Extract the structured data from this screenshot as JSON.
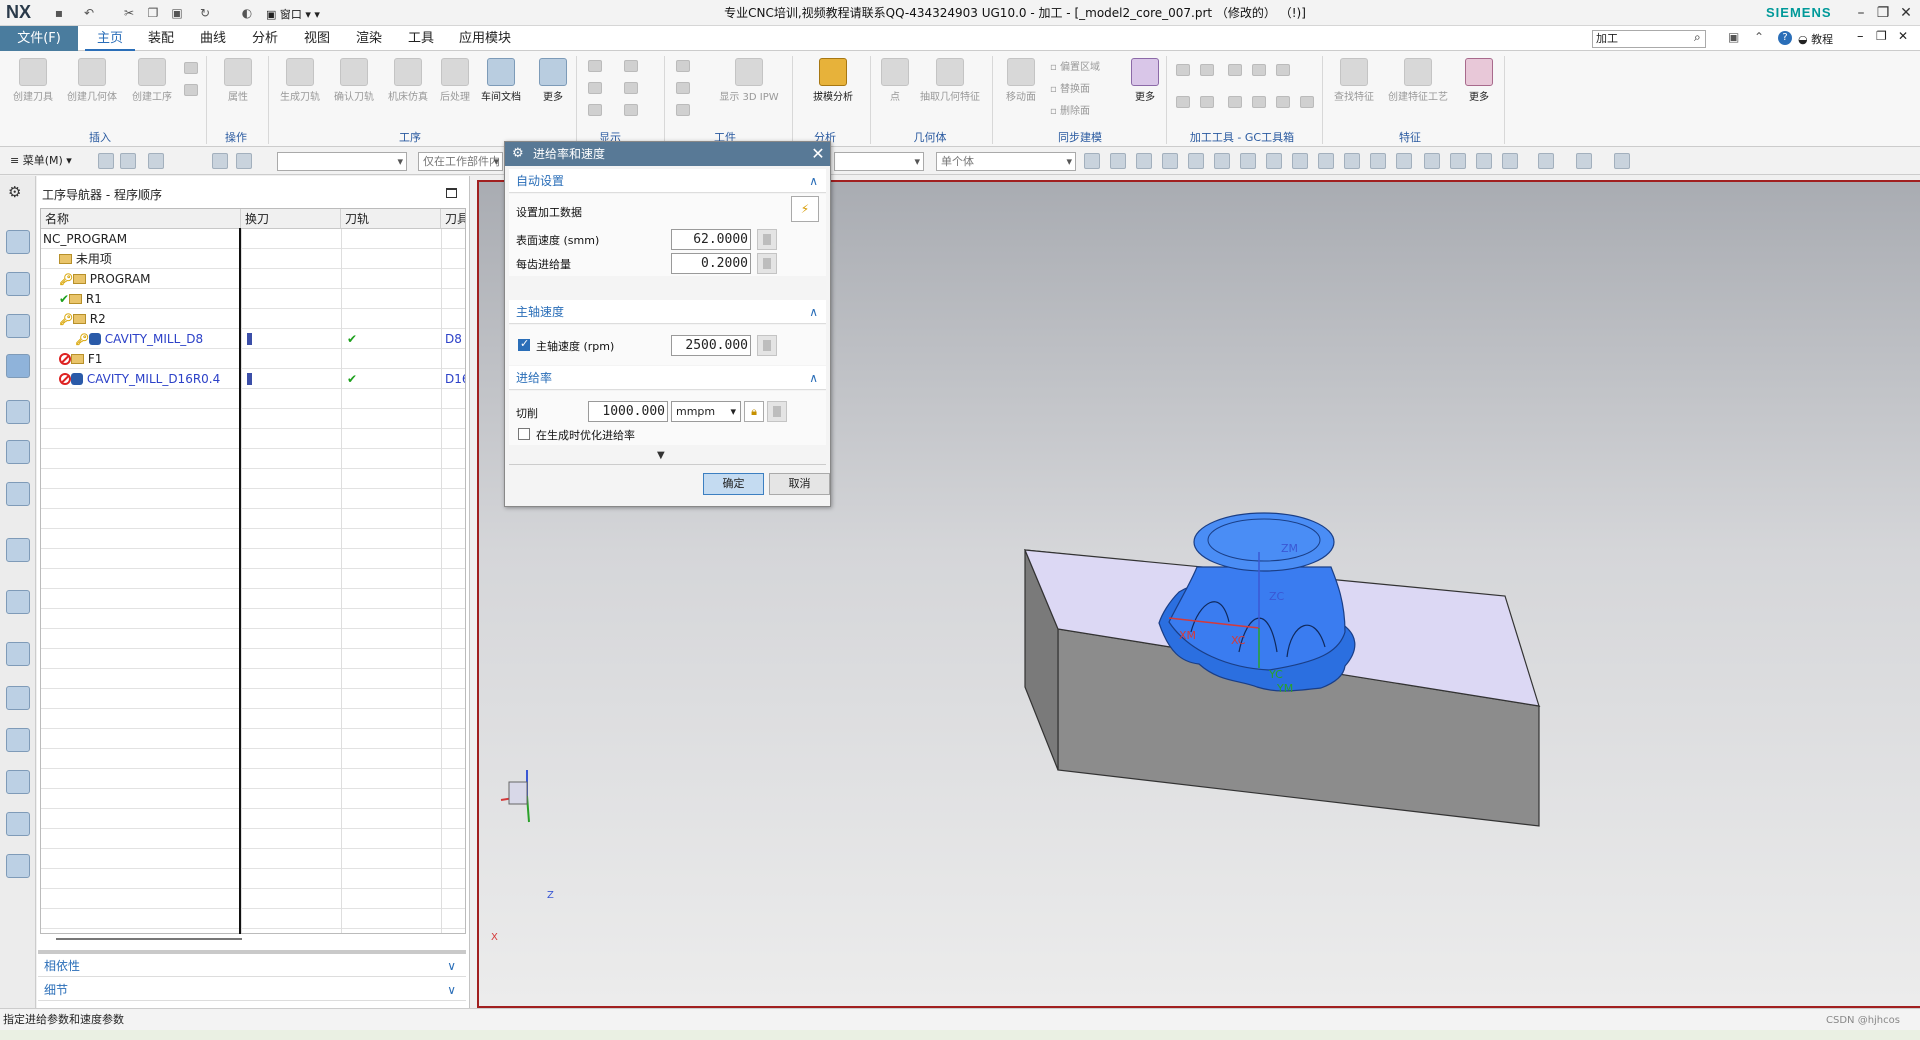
{
  "app": {
    "logo": "NX",
    "title": "专业CNC培训,视频教程请联系QQ-434324903 UG10.0 - 加工 - [_model2_core_007.prt （修改的） （!)]",
    "brand": "SIEMENS",
    "window_label": "窗口",
    "help_label": "教程"
  },
  "menu": {
    "file": "文件(F)",
    "tabs": [
      "主页",
      "装配",
      "曲线",
      "分析",
      "视图",
      "渲染",
      "工具",
      "应用模块"
    ],
    "search_value": "加工"
  },
  "ribbon": {
    "buttons": [
      "创建刀具",
      "创建几何体",
      "创建工序",
      "属性",
      "生成刀轨",
      "确认刀轨",
      "机床仿真",
      "后处理",
      "车间文档",
      "更多",
      "显示 3D IPW",
      "拔模分析",
      "点",
      "抽取几何特征",
      "移动面",
      "删除面",
      "替换面",
      "偏置区域",
      "更多",
      "查找特征",
      "创建特征工艺",
      "更多"
    ],
    "groups": [
      "插入",
      "操作",
      "工序",
      "显示",
      "工件",
      "分析",
      "几何体",
      "同步建模",
      "加工工具 - GC工具箱",
      "特征"
    ]
  },
  "toolbar": {
    "menu_label": "菜单(M)",
    "filter_placeholder": "仅在工作部件内",
    "body_filter": "单个体",
    "blank_combo": ""
  },
  "navigator": {
    "title": "工序导航器 - 程序顺序",
    "columns": [
      "名称",
      "换刀",
      "刀轨",
      "刀具"
    ],
    "rows": [
      {
        "name": "NC_PROGRAM",
        "depth": 0,
        "status": "",
        "blue": false,
        "toolchange": false,
        "path_ok": false,
        "tool": ""
      },
      {
        "name": "未用项",
        "depth": 1,
        "status": "",
        "blue": false,
        "toolchange": false,
        "path_ok": false,
        "tool": ""
      },
      {
        "name": "PROGRAM",
        "depth": 1,
        "status": "key",
        "blue": false,
        "toolchange": false,
        "path_ok": false,
        "tool": ""
      },
      {
        "name": "R1",
        "depth": 1,
        "status": "check",
        "blue": false,
        "toolchange": false,
        "path_ok": false,
        "tool": ""
      },
      {
        "name": "R2",
        "depth": 1,
        "status": "key",
        "blue": false,
        "toolchange": false,
        "path_ok": false,
        "tool": ""
      },
      {
        "name": "CAVITY_MILL_D8",
        "depth": 2,
        "status": "key",
        "blue": true,
        "toolchange": true,
        "path_ok": true,
        "tool": "D8"
      },
      {
        "name": "F1",
        "depth": 1,
        "status": "noentry",
        "blue": false,
        "toolchange": false,
        "path_ok": false,
        "tool": ""
      },
      {
        "name": "CAVITY_MILL_D16R0.4",
        "depth": 1,
        "status": "noentry",
        "blue": true,
        "toolchange": true,
        "path_ok": true,
        "tool": "D16"
      }
    ],
    "panels": [
      "相依性",
      "细节"
    ]
  },
  "dialog": {
    "title": "进给率和速度",
    "auto_section": "自动设置",
    "set_data_label": "设置加工数据",
    "surface_speed_label": "表面速度 (smm)",
    "surface_speed": "62.0000",
    "feed_per_tooth_label": "每齿进给量",
    "feed_per_tooth": "0.2000",
    "spindle_section": "主轴速度",
    "spindle_label": "主轴速度 (rpm)",
    "spindle_checked": true,
    "spindle_value": "2500.000",
    "feed_section": "进给率",
    "cut_label": "切削",
    "cut_value": "1000.000",
    "cut_unit": "mmpm",
    "optimize_label": "在生成时优化进给率",
    "optimize_checked": false,
    "ok": "确定",
    "cancel": "取消"
  },
  "viewport": {
    "axis_labels": [
      "ZM",
      "ZC",
      "XM",
      "XC",
      "YC",
      "YM"
    ],
    "triad": [
      "Z",
      "X"
    ]
  },
  "status": {
    "message": "指定进给参数和速度参数",
    "watermark": "CSDN @hjhcos"
  },
  "colors": {
    "accent": "#2a6eb8",
    "file_tab": "#4a7c9e",
    "dialog_title": "#587996",
    "model_blue": "#2b6fe0",
    "block_top": "#dcd8f4",
    "viewport_border": "#a12020"
  }
}
